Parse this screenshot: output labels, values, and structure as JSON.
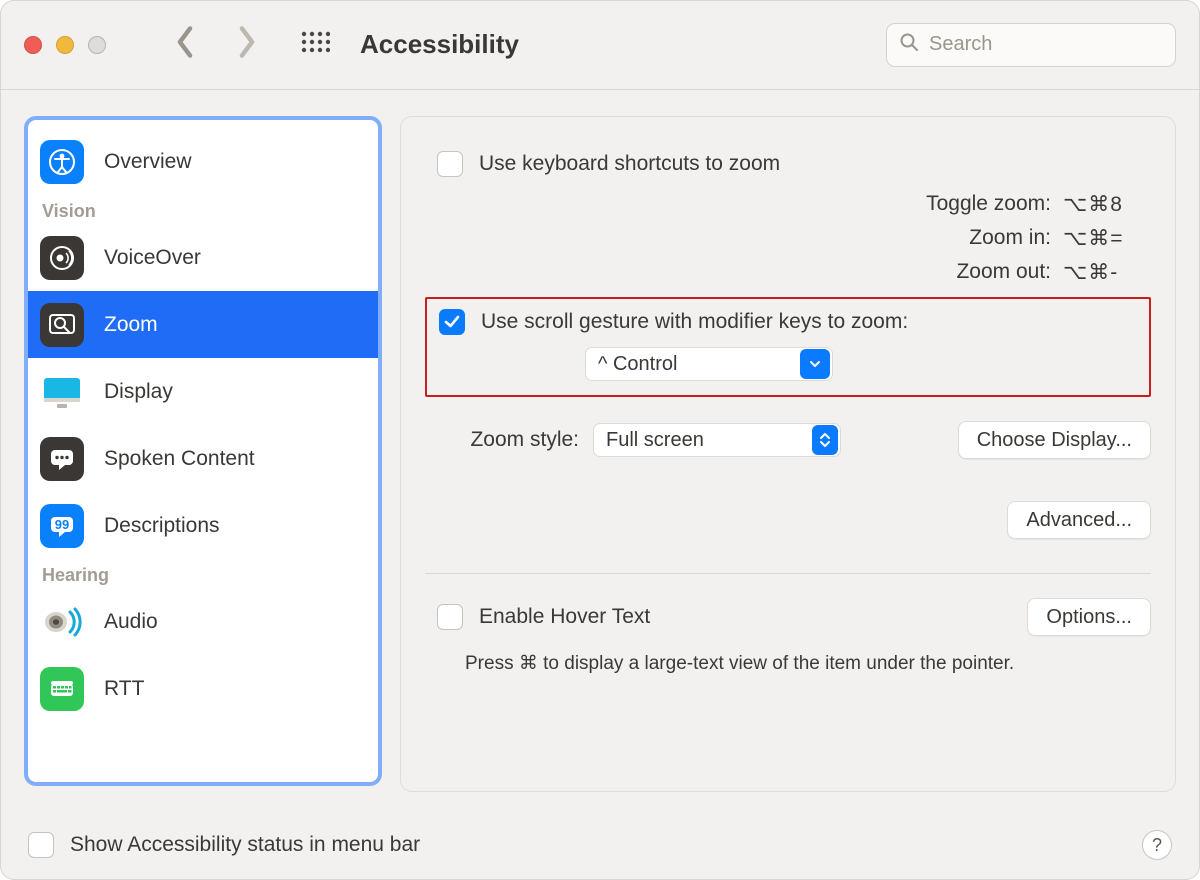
{
  "window": {
    "title": "Accessibility"
  },
  "search": {
    "placeholder": "Search"
  },
  "sidebar": {
    "headings": {
      "vision": "Vision",
      "hearing": "Hearing"
    },
    "items": {
      "overview": {
        "label": "Overview"
      },
      "voiceover": {
        "label": "VoiceOver"
      },
      "zoom": {
        "label": "Zoom"
      },
      "display": {
        "label": "Display"
      },
      "spoken": {
        "label": "Spoken Content"
      },
      "desc": {
        "label": "Descriptions"
      },
      "audio": {
        "label": "Audio"
      },
      "rtt": {
        "label": "RTT"
      }
    }
  },
  "main": {
    "kb_shortcuts_label": "Use keyboard shortcuts to zoom",
    "shortcuts": {
      "toggle": {
        "label": "Toggle zoom:",
        "keys": "⌥⌘8"
      },
      "in": {
        "label": "Zoom in:",
        "keys": "⌥⌘="
      },
      "out": {
        "label": "Zoom out:",
        "keys": "⌥⌘-"
      }
    },
    "scroll_gesture_label": "Use scroll gesture with modifier keys to zoom:",
    "modifier_value": "^ Control",
    "zoom_style_label": "Zoom style:",
    "zoom_style_value": "Full screen",
    "choose_display": "Choose Display...",
    "advanced": "Advanced...",
    "hover_text_label": "Enable Hover Text",
    "options": "Options...",
    "hover_desc": "Press ⌘ to display a large-text view of the item under the pointer."
  },
  "footer": {
    "status_label": "Show Accessibility status in menu bar",
    "help": "?"
  }
}
